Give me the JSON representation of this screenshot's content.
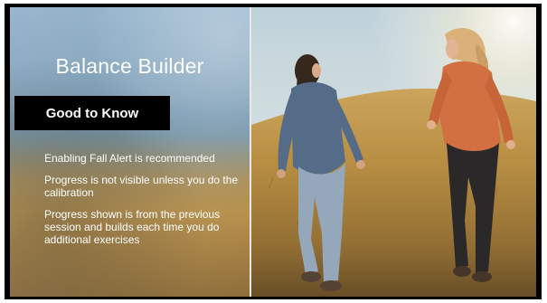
{
  "slide": {
    "title": "Balance Builder",
    "subtitle": "Good to Know",
    "bullets": [
      "Enabling Fall Alert is recommended",
      "Progress is not visible unless you do the calibration",
      "Progress shown is from the previous session and builds each time you do additional exercises"
    ]
  },
  "colors": {
    "frame": "#000000",
    "text": "#ffffff",
    "subtitle_bg": "#000000",
    "sky": "#c9dbe6",
    "field": "#b38a3d"
  },
  "photo": {
    "subject": "two women walking up a grassy hill"
  }
}
